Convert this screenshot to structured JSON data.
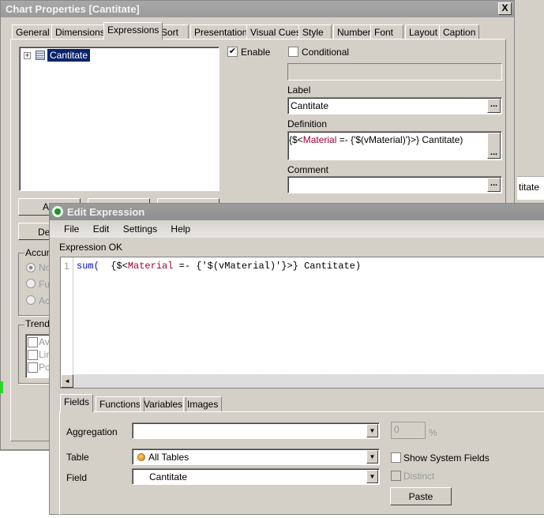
{
  "background": {
    "partial_text": "titate"
  },
  "chart_properties": {
    "title": "Chart Properties [Cantitate]",
    "close_label": "X",
    "tabs": [
      "General",
      "Dimensions",
      "Expressions",
      "Sort",
      "Presentation",
      "Visual Cues",
      "Style",
      "Number",
      "Font",
      "Layout",
      "Caption"
    ],
    "active_tab": "Expressions",
    "tree": {
      "items": [
        {
          "label": "Cantitate",
          "expand": "+",
          "selected": true
        }
      ]
    },
    "enable": {
      "label": "Enable",
      "checked": true,
      "mark": "✔"
    },
    "conditional": {
      "label": "Conditional",
      "checked": false
    },
    "label_field": {
      "label": "Label",
      "value": "Cantitate",
      "button": "..."
    },
    "definition": {
      "label": "Definition",
      "value_parts": [
        "{$<",
        "Material",
        " =- {'$(vMaterial)'}>} Cantitate)"
      ],
      "button": "..."
    },
    "comment": {
      "label": "Comment",
      "value": "",
      "button": "..."
    },
    "buttons_partial": [
      "Ad",
      "Del"
    ],
    "accumulation": {
      "label": "Accum",
      "options": [
        "No",
        "Fu",
        "Ac"
      ]
    },
    "trendlines": {
      "label": "Trendl",
      "options": [
        "Av",
        "Lin",
        "Po"
      ]
    }
  },
  "edit_expression": {
    "title": "Edit Expression",
    "menu": [
      "File",
      "Edit",
      "Settings",
      "Help"
    ],
    "status": "Expression OK",
    "editor": {
      "line_number": "1",
      "code_parts": {
        "func": "sum(",
        "space": "  ",
        "p1": "{$<",
        "field": "Material",
        "p2": " =- {'$(vMaterial)'}>} Cantitate)"
      }
    },
    "colors": {
      "keyword": "#0000cc",
      "field": "#a00030"
    },
    "scroll_left": "◄",
    "tabs": [
      "Fields",
      "Functions",
      "Variables",
      "Images"
    ],
    "active_tab": "Fields",
    "aggregation": {
      "label": "Aggregation",
      "value": "",
      "percent_value": "0",
      "percent_sign": "%"
    },
    "table": {
      "label": "Table",
      "value": "All Tables"
    },
    "field": {
      "label": "Field",
      "value": "Cantitate"
    },
    "show_system_fields": {
      "label": "Show System Fields",
      "checked": false
    },
    "distinct": {
      "label": "Distinct",
      "checked": false,
      "disabled": true
    },
    "paste_label": "Paste",
    "arrow": "▼"
  }
}
